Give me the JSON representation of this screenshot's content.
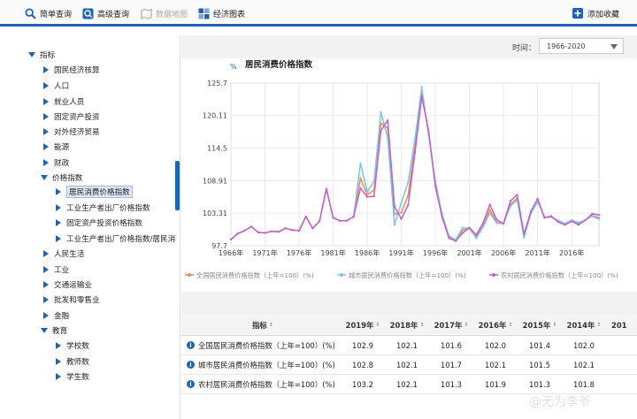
{
  "toolbar": {
    "simple_query": "简单查询",
    "advanced_query": "高级查询",
    "data_map": "数据地图",
    "econ_chart": "经济图表",
    "add_favorite": "添加收藏"
  },
  "sidebar": {
    "root": "指标",
    "items": [
      {
        "label": "国民经济核算"
      },
      {
        "label": "人口"
      },
      {
        "label": "就业人员"
      },
      {
        "label": "固定资产投资"
      },
      {
        "label": "对外经济贸易"
      },
      {
        "label": "能源"
      },
      {
        "label": "财政"
      },
      {
        "label": "价格指数"
      },
      {
        "label": "居民消费价格指数"
      },
      {
        "label": "工业生产者出厂价格指数"
      },
      {
        "label": "固定资产投资价格指数"
      },
      {
        "label": "工业生产者出厂价格指数/居民消"
      },
      {
        "label": "人民生活"
      },
      {
        "label": "工业"
      },
      {
        "label": "交通运输业"
      },
      {
        "label": "批发和零售业"
      },
      {
        "label": "金融"
      },
      {
        "label": "教育"
      },
      {
        "label": "学校数"
      },
      {
        "label": "教师数"
      },
      {
        "label": "学生数"
      }
    ]
  },
  "time_filter": {
    "label": "时间：",
    "value": "1966-2020"
  },
  "chart_data": {
    "type": "line",
    "title": "居民消费价格指数",
    "ylabel": "%",
    "xlabel": "",
    "ylim": [
      97.7,
      125.7
    ],
    "yticks": [
      "125.7",
      "120.11",
      "114.5",
      "108.91",
      "103.31",
      "97.7"
    ],
    "xticks": [
      "1966年",
      "1971年",
      "1976年",
      "1981年",
      "1986年",
      "1991年",
      "1996年",
      "2001年",
      "2006年",
      "2011年",
      "2016年"
    ],
    "grid": true,
    "legend_position": "bottom",
    "x": [
      1966,
      1967,
      1968,
      1969,
      1970,
      1971,
      1972,
      1973,
      1974,
      1975,
      1976,
      1977,
      1978,
      1979,
      1980,
      1981,
      1982,
      1983,
      1984,
      1985,
      1986,
      1987,
      1988,
      1989,
      1990,
      1991,
      1992,
      1993,
      1994,
      1995,
      1996,
      1997,
      1998,
      1999,
      2000,
      2001,
      2002,
      2003,
      2004,
      2005,
      2006,
      2007,
      2008,
      2009,
      2010,
      2011,
      2012,
      2013,
      2014,
      2015,
      2016,
      2017,
      2018,
      2019,
      2020
    ],
    "series": [
      {
        "name": "全国居民消费价格指数（上年=100）(%)",
        "color": "#f08a50",
        "values": [
          98.8,
          99.8,
          100.3,
          101.0,
          100.0,
          99.9,
          100.2,
          100.1,
          100.7,
          100.4,
          100.3,
          102.7,
          100.7,
          101.9,
          107.5,
          102.5,
          102.0,
          102.0,
          102.7,
          109.3,
          106.5,
          107.3,
          118.8,
          118.0,
          103.1,
          103.4,
          106.4,
          114.7,
          124.1,
          117.1,
          108.3,
          102.8,
          99.2,
          98.6,
          100.4,
          100.7,
          99.2,
          101.2,
          103.9,
          101.8,
          101.5,
          104.8,
          105.9,
          99.3,
          103.3,
          105.4,
          102.6,
          102.6,
          102.0,
          101.4,
          102.0,
          101.6,
          102.1,
          102.9,
          102.5
        ]
      },
      {
        "name": "城市居民消费价格指数（上年=100）(%)",
        "color": "#7cc4ea",
        "values": [
          98.8,
          99.8,
          100.3,
          101.0,
          100.0,
          99.9,
          100.2,
          100.1,
          100.7,
          100.4,
          100.3,
          102.7,
          100.7,
          101.9,
          107.5,
          102.5,
          102.0,
          102.0,
          102.7,
          111.9,
          107.0,
          108.8,
          120.7,
          116.3,
          101.3,
          105.1,
          108.6,
          116.1,
          125.0,
          116.8,
          108.8,
          103.1,
          99.4,
          98.7,
          100.8,
          100.7,
          99.0,
          100.9,
          103.3,
          101.6,
          101.5,
          104.5,
          105.6,
          99.1,
          103.2,
          105.3,
          102.7,
          102.6,
          102.1,
          101.5,
          102.1,
          101.7,
          102.1,
          102.8,
          102.3
        ]
      },
      {
        "name": "农村居民消费价格指数（上年=100）(%)",
        "color": "#c560c8",
        "values": [
          98.8,
          99.8,
          100.3,
          101.0,
          100.0,
          99.9,
          100.2,
          100.1,
          100.7,
          100.4,
          100.3,
          102.7,
          100.7,
          101.9,
          107.5,
          102.5,
          102.0,
          102.0,
          102.7,
          107.6,
          106.1,
          106.2,
          117.5,
          119.3,
          104.5,
          102.3,
          104.7,
          113.7,
          123.4,
          117.5,
          107.9,
          102.5,
          99.0,
          98.5,
          99.9,
          100.8,
          99.6,
          101.6,
          104.8,
          102.2,
          101.5,
          105.4,
          106.5,
          99.7,
          103.6,
          105.8,
          102.5,
          102.8,
          101.8,
          101.3,
          101.9,
          101.3,
          102.1,
          103.2,
          103.0
        ]
      }
    ],
    "legend": [
      "全国居民消费价格指数（上年=100）(%)",
      "城市居民消费价格指数（上年=100）(%)",
      "农村居民消费价格指数（上年=100）(%)"
    ]
  },
  "table": {
    "columns": [
      "指标",
      "2019年",
      "2018年",
      "2017年",
      "2016年",
      "2015年",
      "2014年",
      "201"
    ],
    "rows": [
      {
        "label": "全国居民消费价格指数（上年=100）(%)",
        "values": [
          "102.9",
          "102.1",
          "101.6",
          "102.0",
          "101.4",
          "102.0"
        ]
      },
      {
        "label": "城市居民消费价格指数（上年=100）(%)",
        "values": [
          "102.8",
          "102.1",
          "101.7",
          "102.1",
          "101.5",
          "102.1"
        ]
      },
      {
        "label": "农村居民消费价格指数（上年=100）(%)",
        "values": [
          "103.2",
          "102.1",
          "101.3",
          "101.9",
          "101.3",
          "101.8"
        ]
      }
    ]
  },
  "watermark": "@无为李爷",
  "colors": {
    "accent": "#1f63b4"
  }
}
